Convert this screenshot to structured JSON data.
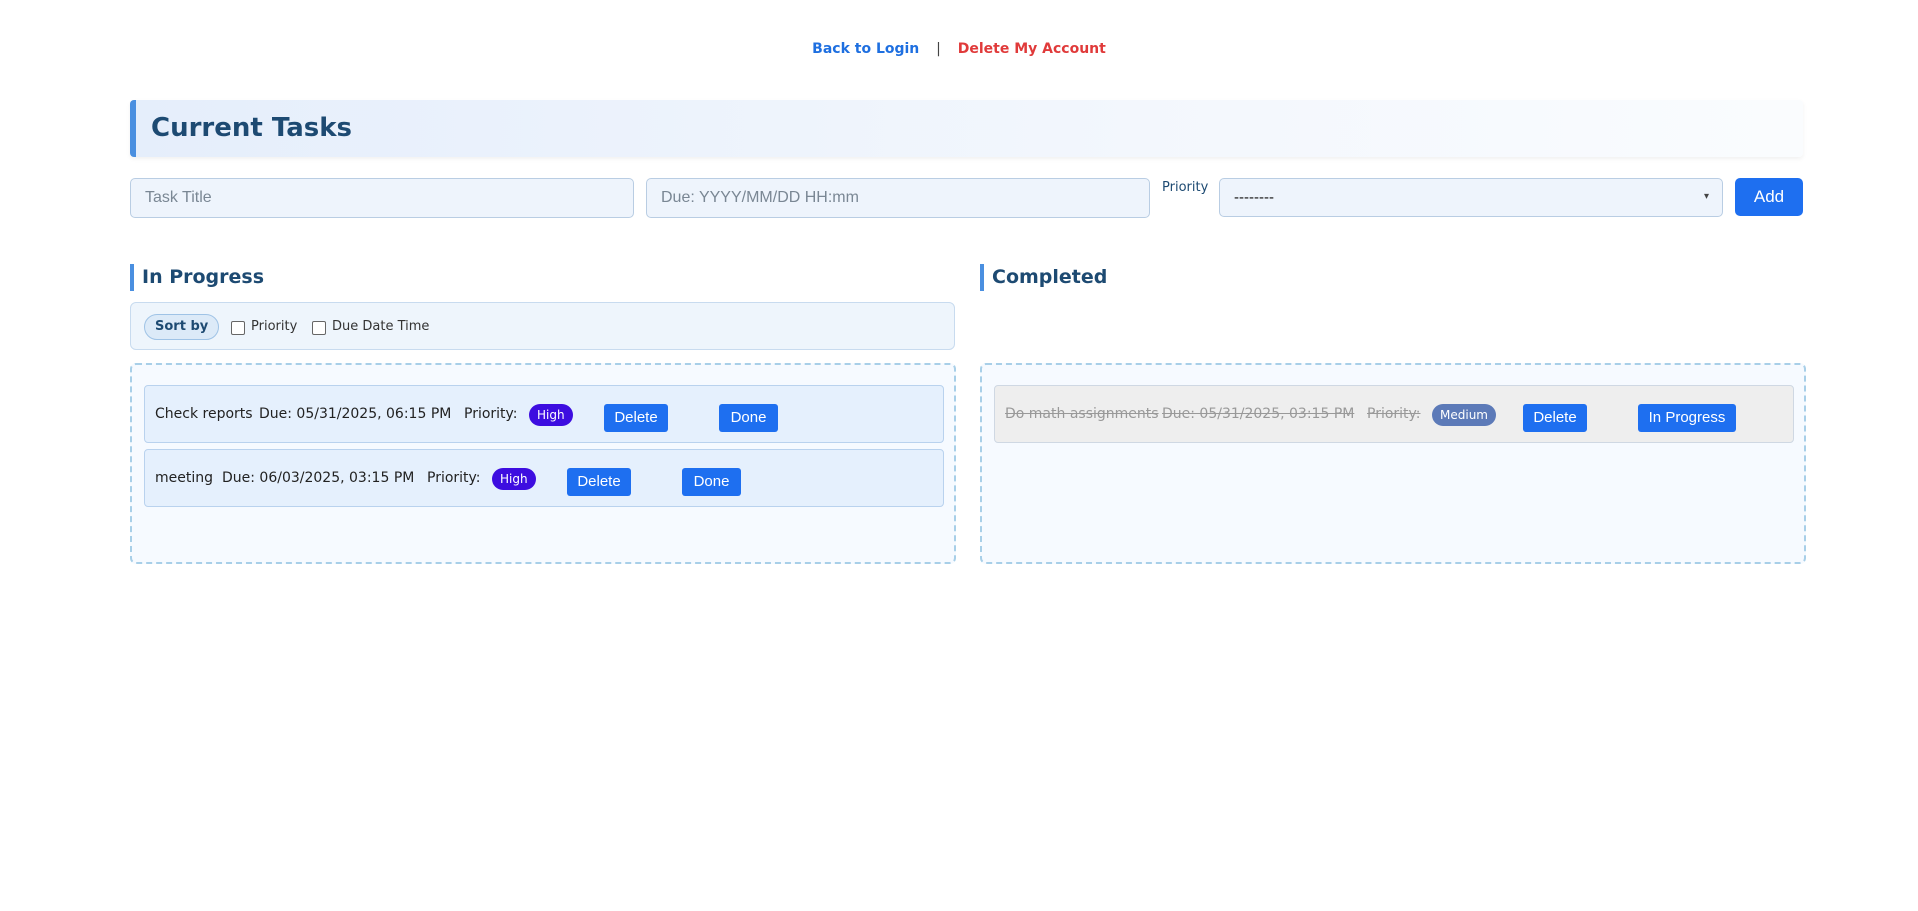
{
  "nav": {
    "back_label": "Back to Login",
    "separator": "|",
    "delete_account_label": "Delete My Account"
  },
  "header": {
    "title": "Current Tasks"
  },
  "form": {
    "title_placeholder": "Task Title",
    "due_placeholder": "Due: YYYY/MM/DD HH:mm",
    "priority_label": "Priority",
    "priority_selected": "--------",
    "add_label": "Add"
  },
  "in_progress": {
    "title": "In Progress",
    "sort_label": "Sort by",
    "sort_priority": "Priority",
    "sort_due": "Due Date Time",
    "tasks": [
      {
        "title": "Check reports",
        "due": "Due: 05/31/2025, 06:15 PM",
        "priority_label": "Priority:",
        "priority": "High",
        "delete": "Delete",
        "action": "Done"
      },
      {
        "title": "meeting",
        "due": "Due: 06/03/2025, 03:15 PM",
        "priority_label": "Priority:",
        "priority": "High",
        "delete": "Delete",
        "action": "Done"
      }
    ]
  },
  "completed": {
    "title": "Completed",
    "tasks": [
      {
        "title": "Do math assignments",
        "due": "Due: 05/31/2025, 03:15 PM",
        "priority_label": "Priority:",
        "priority": "Medium",
        "delete": "Delete",
        "action": "In Progress"
      }
    ]
  },
  "colors": {
    "accent": "#1e6ff0",
    "danger": "#e03a3a",
    "high": "#3d0de0",
    "medium": "#5c7ab8",
    "heading": "#1d4a72"
  }
}
